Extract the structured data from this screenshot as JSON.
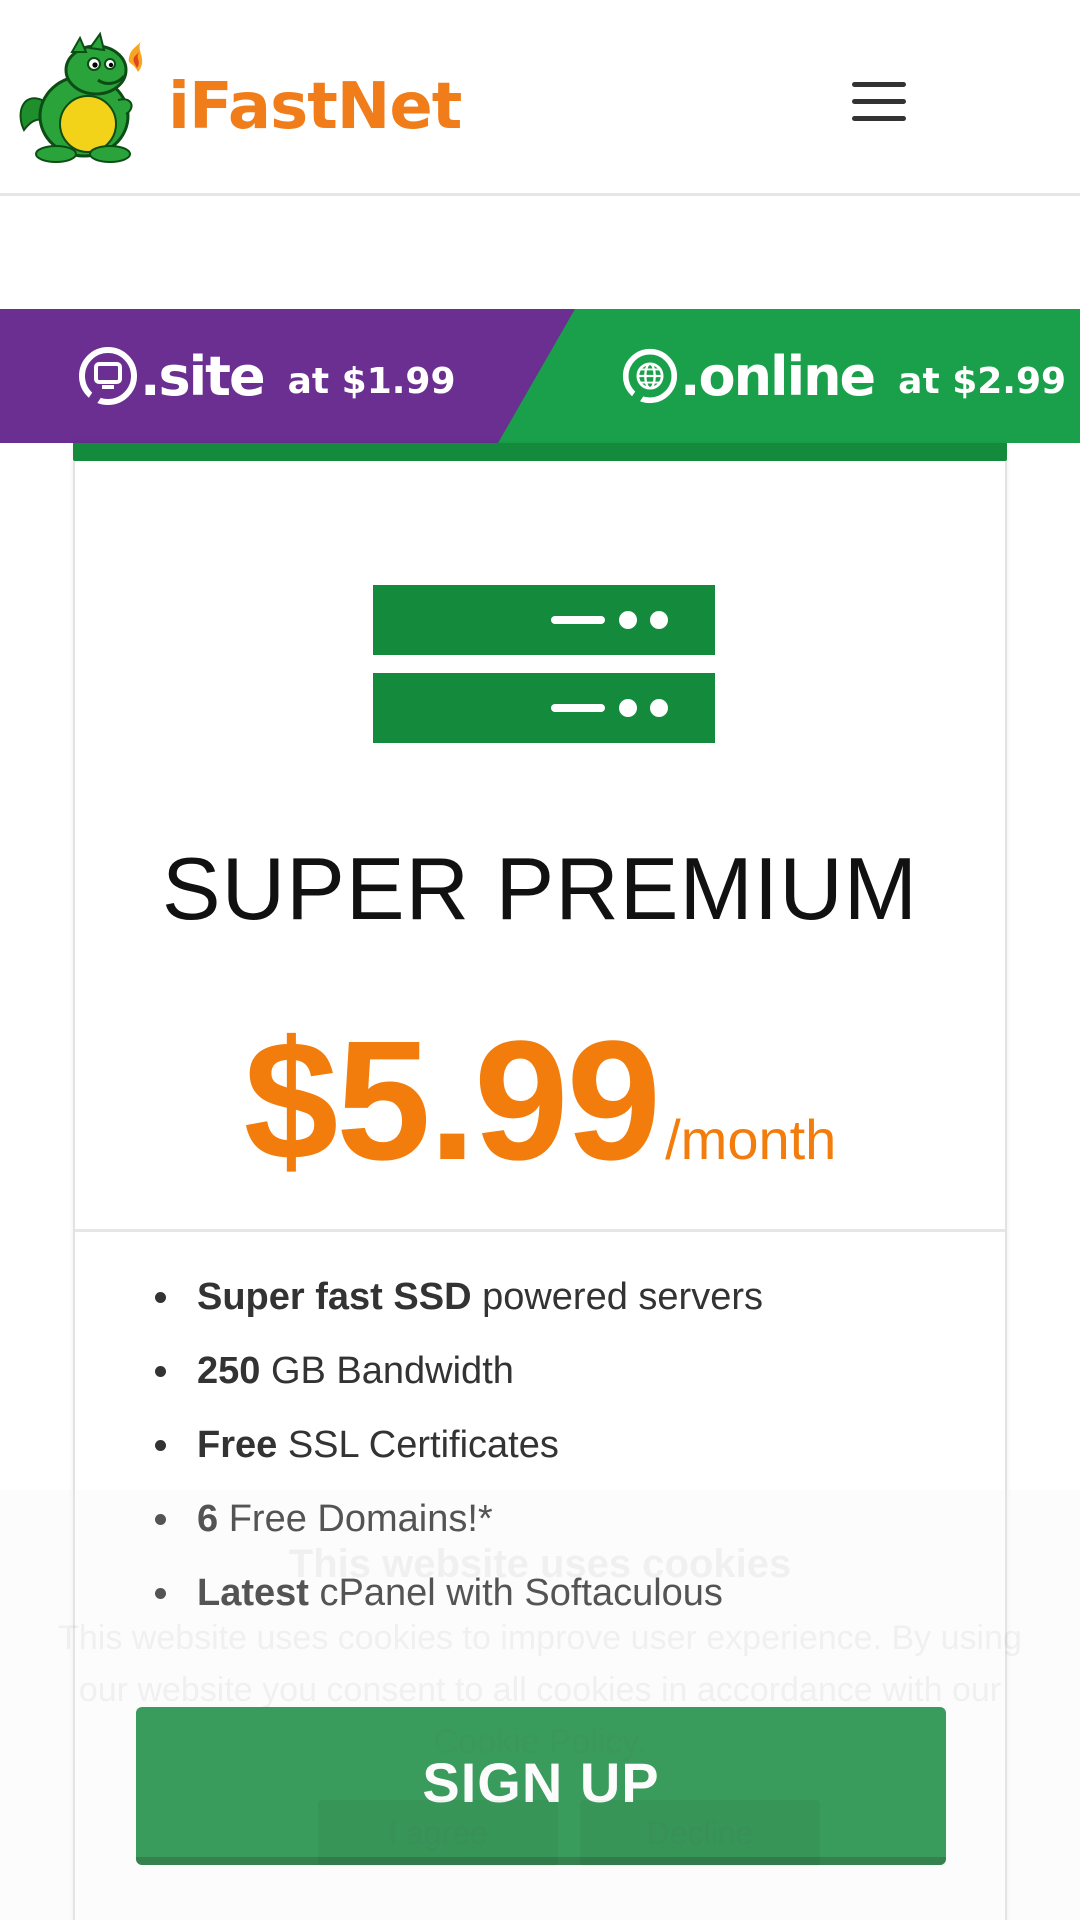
{
  "header": {
    "brand": "iFastNet",
    "logo_icon": "dragon-mascot-icon",
    "menu_icon": "hamburger-menu-icon"
  },
  "promo": {
    "site": {
      "extension": ".site",
      "price_text": "at $1.99",
      "color": "#6a2f90",
      "icon": "monitor-icon"
    },
    "online": {
      "extension": ".online",
      "price_text": "at $2.99",
      "color": "#1aa04a",
      "icon": "globe-icon"
    }
  },
  "plan": {
    "icon": "server-icon",
    "title": "SUPER PREMIUM",
    "price": "$5.99",
    "period": "/month",
    "accent_color": "#138a3c",
    "price_color": "#f27d0c",
    "features": [
      {
        "bold": "Super fast SSD",
        "text": " powered servers"
      },
      {
        "bold": "250",
        "text": " GB Bandwidth"
      },
      {
        "bold": "Free",
        "text": " SSL Certificates"
      },
      {
        "bold": "6",
        "text": " Free Domains!*"
      },
      {
        "bold": "Latest",
        "text": " cPanel with Softaculous"
      }
    ],
    "cta_label": "SIGN UP"
  },
  "cookie_notice": {
    "title": "This website uses cookies",
    "text": "This website uses cookies to improve user experience. By using our website you consent to all cookies in accordance with our Cookie Policy.",
    "accept_label": "I agree",
    "decline_label": "Decline"
  }
}
